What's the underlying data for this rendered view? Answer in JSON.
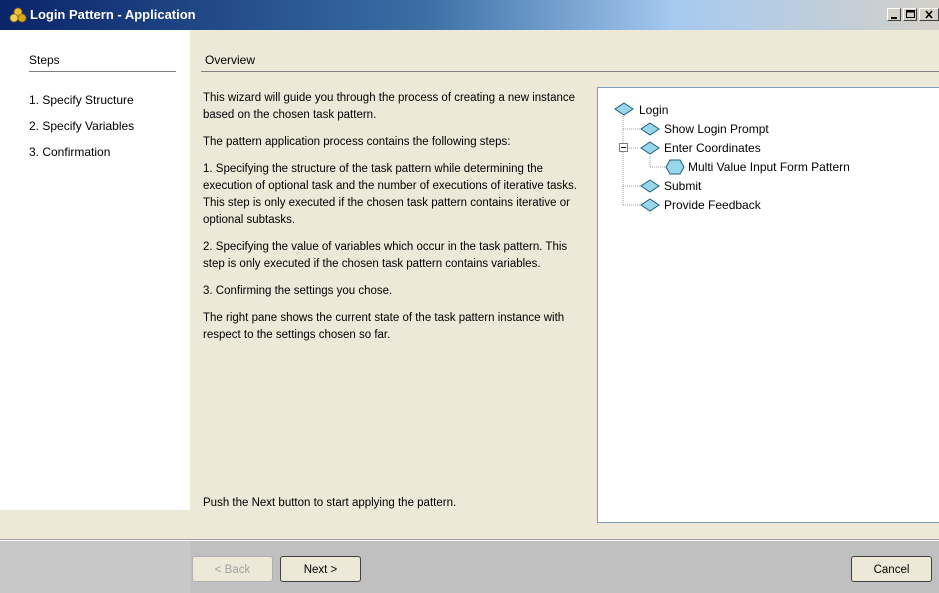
{
  "window": {
    "title": "Login Pattern - Application",
    "controls": [
      "minimize",
      "maximize",
      "close"
    ]
  },
  "steps": {
    "header": "Steps",
    "items": [
      "1. Specify Structure",
      "2. Specify Variables",
      "3. Confirmation"
    ]
  },
  "overview": {
    "header": "Overview",
    "paragraphs": [
      "This wizard will guide you through the process of creating a new instance based on the chosen task pattern.",
      "The pattern application process contains the following steps:",
      "1. Specifying the structure of the task pattern while determining the execution of optional task and the number of executions of iterative tasks. This step is only executed if the chosen task pattern contains iterative or optional subtasks.",
      "2. Specifying the value of variables which occur in the task pattern. This step is only executed if the chosen task pattern contains variables.",
      "3. Confirming the settings you chose.",
      "The right pane shows the current state of the task pattern instance with respect to the settings chosen so far."
    ],
    "footer": "Push the Next button to start applying the pattern."
  },
  "tree": {
    "root": "Login",
    "children": [
      "Show Login Prompt",
      "Enter Coordinates",
      "Multi Value Input Form Pattern",
      "Submit",
      "Provide Feedback"
    ]
  },
  "buttons": {
    "back": "< Back",
    "next": "Next >",
    "cancel": "Cancel"
  },
  "colors": {
    "title_bar_start": "#0a246a",
    "node_fill": "#9ad6ea",
    "node_stroke": "#1f5f80",
    "panel_bg": "#ece9d8"
  }
}
